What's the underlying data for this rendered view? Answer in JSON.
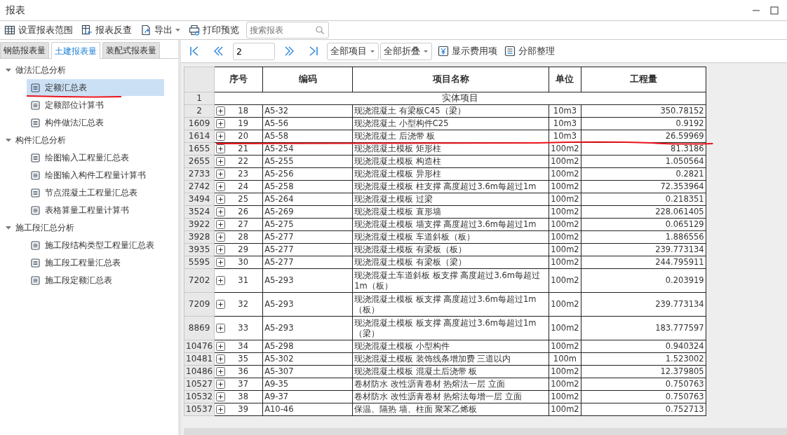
{
  "window": {
    "title": "报表"
  },
  "toolbar": {
    "buttons": [
      {
        "kind": "range",
        "label": "设置报表范围"
      },
      {
        "kind": "lookup",
        "label": "报表反查"
      },
      {
        "kind": "export",
        "label": "导出",
        "dropdown": true
      },
      {
        "kind": "print",
        "label": "打印预览"
      }
    ],
    "search": {
      "placeholder": "搜索报表"
    }
  },
  "tabs": [
    {
      "label": "钢筋报表量",
      "selected": false
    },
    {
      "label": "土建报表量",
      "selected": true
    },
    {
      "label": "装配式报表量",
      "selected": false
    }
  ],
  "tree": [
    {
      "label": "做法汇总分析",
      "expanded": true,
      "children": [
        {
          "label": "定额汇总表",
          "selected": true
        },
        {
          "label": "定额部位计算书",
          "selected": false
        },
        {
          "label": "构件做法汇总表",
          "selected": false
        }
      ]
    },
    {
      "label": "构件汇总分析",
      "expanded": true,
      "children": [
        {
          "label": "绘图输入工程量汇总表",
          "selected": false
        },
        {
          "label": "绘图输入构件工程量计算书",
          "selected": false
        },
        {
          "label": "节点混凝土工程量汇总表",
          "selected": false
        },
        {
          "label": "表格算量工程量计算书",
          "selected": false
        }
      ]
    },
    {
      "label": "施工段汇总分析",
      "expanded": true,
      "children": [
        {
          "label": "施工段结构类型工程量汇总表",
          "selected": false
        },
        {
          "label": "施工段工程量汇总表",
          "selected": false
        },
        {
          "label": "施工段定额汇总表",
          "selected": false
        }
      ]
    }
  ],
  "pager": {
    "page": "2"
  },
  "report_toolbar": {
    "dropdowns": [
      "全部项目",
      "全部折叠"
    ],
    "buttons": [
      {
        "kind": "fees",
        "label": "显示费用项"
      },
      {
        "kind": "organize",
        "label": "分部整理"
      }
    ]
  },
  "table": {
    "columns": [
      "序号",
      "编码",
      "项目名称",
      "单位",
      "工程量"
    ],
    "rows": [
      {
        "kind": "group",
        "row_number": "1",
        "name": "实体项目"
      },
      {
        "kind": "item",
        "row_number": "2",
        "expanded": false,
        "number": "18",
        "code": "A5-32",
        "name": "现浇混凝土 有梁板C45（梁）",
        "unit": "10m3",
        "quantity": "350.78152"
      },
      {
        "kind": "item",
        "row_number": "1609",
        "expanded": false,
        "number": "19",
        "code": "A5-56",
        "name": "现浇混凝土 小型构件C25",
        "unit": "10m3",
        "quantity": "0.9192"
      },
      {
        "kind": "item",
        "row_number": "1614",
        "expanded": false,
        "number": "20",
        "code": "A5-58",
        "name": "现浇混凝土 后浇带 板",
        "unit": "10m3",
        "quantity": "26.59969"
      },
      {
        "kind": "item",
        "row_number": "1655",
        "expanded": false,
        "number": "21",
        "code": "A5-254",
        "name": "现浇混凝土模板 矩形柱",
        "unit": "100m2",
        "quantity": "81.3186"
      },
      {
        "kind": "item",
        "row_number": "2655",
        "expanded": false,
        "number": "22",
        "code": "A5-255",
        "name": "现浇混凝土模板 构造柱",
        "unit": "100m2",
        "quantity": "1.050564"
      },
      {
        "kind": "item",
        "row_number": "2733",
        "expanded": false,
        "number": "23",
        "code": "A5-256",
        "name": "现浇混凝土模板 异形柱",
        "unit": "100m2",
        "quantity": "0.2821"
      },
      {
        "kind": "item",
        "row_number": "2742",
        "expanded": false,
        "number": "24",
        "code": "A5-258",
        "name": "现浇混凝土模板 柱支撑 高度超过3.6m每超过1m",
        "unit": "100m2",
        "quantity": "72.353964"
      },
      {
        "kind": "item",
        "row_number": "3494",
        "expanded": false,
        "number": "25",
        "code": "A5-264",
        "name": "现浇混凝土模板 过梁",
        "unit": "100m2",
        "quantity": "0.218351"
      },
      {
        "kind": "item",
        "row_number": "3524",
        "expanded": false,
        "number": "26",
        "code": "A5-269",
        "name": "现浇混凝土模板 直形墙",
        "unit": "100m2",
        "quantity": "228.061405"
      },
      {
        "kind": "item",
        "row_number": "3922",
        "expanded": false,
        "number": "27",
        "code": "A5-275",
        "name": "现浇混凝土模板 墙支撑 高度超过3.6m每超过1m",
        "unit": "100m2",
        "quantity": "0.065129"
      },
      {
        "kind": "item",
        "row_number": "3928",
        "expanded": false,
        "number": "28",
        "code": "A5-277",
        "name": "现浇混凝土模板 车道斜板（板）",
        "unit": "100m2",
        "quantity": "1.886556"
      },
      {
        "kind": "item",
        "row_number": "3935",
        "expanded": false,
        "number": "29",
        "code": "A5-277",
        "name": "现浇混凝土模板 有梁板（板）",
        "unit": "100m2",
        "quantity": "239.773134"
      },
      {
        "kind": "item",
        "row_number": "5595",
        "expanded": false,
        "number": "30",
        "code": "A5-277",
        "name": "现浇混凝土模板 有梁板（梁）",
        "unit": "100m2",
        "quantity": "244.795911"
      },
      {
        "kind": "item",
        "row_number": "7202",
        "expanded": false,
        "number": "31",
        "code": "A5-293",
        "name": "现浇混凝土车道斜板 板支撑 高度超过3.6m每超过1m（板）",
        "unit": "100m2",
        "quantity": "0.203919"
      },
      {
        "kind": "item",
        "row_number": "7209",
        "expanded": false,
        "number": "32",
        "code": "A5-293",
        "name": "现浇混凝土模板 板支撑 高度超过3.6m每超过1m（板）",
        "unit": "100m2",
        "quantity": "239.773134"
      },
      {
        "kind": "item",
        "row_number": "8869",
        "expanded": false,
        "number": "33",
        "code": "A5-293",
        "name": "现浇混凝土模板 板支撑 高度超过3.6m每超过1m（梁）",
        "unit": "100m2",
        "quantity": "183.777597"
      },
      {
        "kind": "item",
        "row_number": "10476",
        "expanded": false,
        "number": "34",
        "code": "A5-298",
        "name": "现浇混凝土模板 小型构件",
        "unit": "100m2",
        "quantity": "0.940324"
      },
      {
        "kind": "item",
        "row_number": "10481",
        "expanded": false,
        "number": "35",
        "code": "A5-302",
        "name": "现浇混凝土模板 装饰线条增加费 三道以内",
        "unit": "100m",
        "quantity": "1.523002"
      },
      {
        "kind": "item",
        "row_number": "10486",
        "expanded": false,
        "number": "36",
        "code": "A5-307",
        "name": "现浇混凝土模板 混凝土后浇带 板",
        "unit": "100m2",
        "quantity": "12.379805"
      },
      {
        "kind": "item",
        "row_number": "10527",
        "expanded": false,
        "number": "37",
        "code": "A9-35",
        "name": "卷材防水 改性沥青卷材 热熔法一层 立面",
        "unit": "100m2",
        "quantity": "0.750763"
      },
      {
        "kind": "item",
        "row_number": "10532",
        "expanded": false,
        "number": "38",
        "code": "A9-37",
        "name": "卷材防水 改性沥青卷材 热熔法每增一层 立面",
        "unit": "100m2",
        "quantity": "0.750763"
      },
      {
        "kind": "item",
        "row_number": "10537",
        "expanded": false,
        "number": "39",
        "code": "A10-46",
        "name": "保温、隔热 墙、柱面 聚苯乙烯板",
        "unit": "100m2",
        "quantity": "0.752713"
      }
    ]
  }
}
